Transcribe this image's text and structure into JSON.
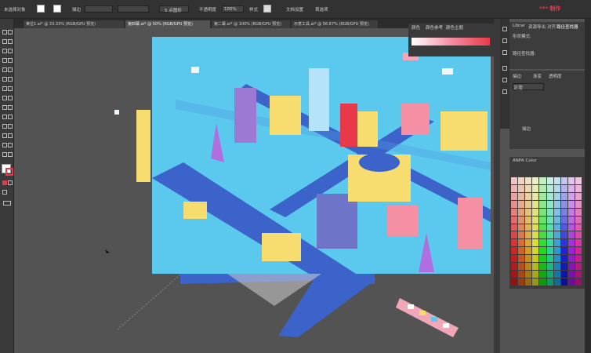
{
  "menu": {
    "selection": "未选择对象",
    "stroke_label": "描边",
    "style_point": "5 点圆形",
    "opacity_label": "不透明度",
    "opacity_value": "100%",
    "style_label": "样式",
    "doc_setup": "文档设置",
    "prefs": "首选项",
    "watermark": "*** 制作"
  },
  "doc_tabs": [
    "莱位1.ai* @ 33.33% (RGB/GPU 预览)",
    "第四幕.ai* @ 50% (RGB/GPU 预览)",
    "第二幕.ai* @ 100% (RGB/GPU 预览)",
    "示意工具.ai* @ 56.67% (RGB/GPU 预览)"
  ],
  "color_panel": {
    "tabs": [
      "颜色",
      "颜色参考",
      "颜色主题"
    ]
  },
  "library": {
    "tabs": [
      "Librar",
      "资源导出",
      "对齐",
      "路径查找器"
    ],
    "shape_modes": "形状模式:",
    "pathfinder": "路径查找器:"
  },
  "props": {
    "tabs": [
      "描边",
      "渐变",
      "透明度"
    ],
    "normal": "正常",
    "stroke_item": "描边"
  },
  "swatch": {
    "title": "ANPA Color"
  },
  "colors": {
    "bg": "#535353",
    "artboard": "#5bc8ee",
    "road": "#3b63c9",
    "accent": "#e8394a"
  }
}
